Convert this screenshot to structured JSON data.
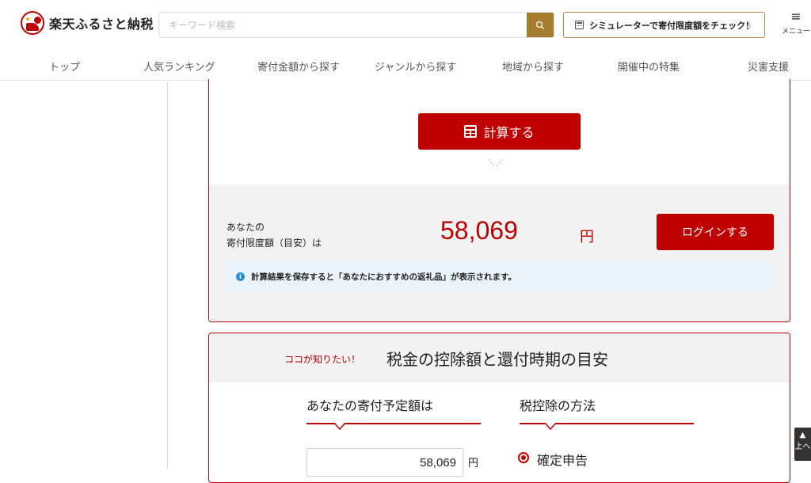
{
  "header": {
    "logo_text": "楽天ふるさと納税",
    "search_placeholder": "キーワード検索",
    "simulator_label": "シミュレーターで寄付限度額をチェック！",
    "menu_label": "メニュー"
  },
  "nav": {
    "items": [
      "トップ",
      "人気ランキング",
      "寄付金額から探す",
      "ジャンルから探す",
      "地域から探す",
      "開催中の特集",
      "災害支援"
    ]
  },
  "calculator": {
    "calc_button": "計算する",
    "result_label_line1": "あなたの",
    "result_label_line2": "寄付限度額（目安）は",
    "result_amount": "58,069",
    "result_unit": "円",
    "login_button": "ログインする",
    "info_text": "計算結果を保存すると「あなたにおすすめの返礼品」が表示されます。"
  },
  "tax": {
    "sub_label": "ココが知りたい！",
    "title": "税金の控除額と還付時期の目安",
    "col1_heading": "あなたの寄付予定額は",
    "col2_heading": "税控除の方法",
    "amount_value": "58,069",
    "amount_unit": "円",
    "method_selected": "確定申告"
  },
  "to_top_label": "上へ",
  "colors": {
    "accent": "#bf0000",
    "gold": "#a67c2f",
    "info": "#2b8fd6"
  }
}
